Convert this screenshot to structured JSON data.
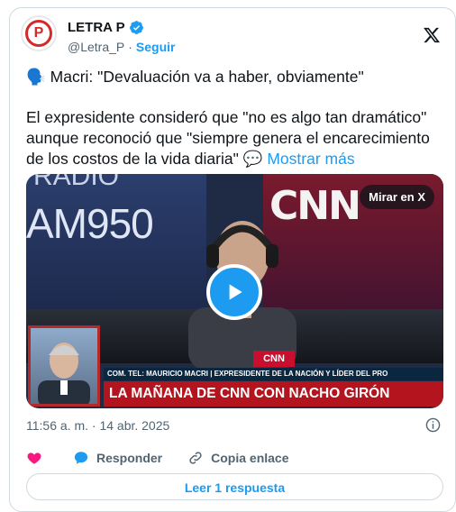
{
  "account": {
    "name": "LETRA P",
    "handle": "@Letra_P",
    "separator": "·",
    "follow_label": "Seguir",
    "avatar_letter": "P"
  },
  "tweet": {
    "line1": "🗣️ Macri: \"Devaluación va a haber, obviamente\"",
    "body": "El expresidente consideró que \"no es algo tan dramático\" aunque reconoció que \"siempre genera el encarecimiento de los costos de la vida diaria\"",
    "more_emoji": "💬",
    "more_label": "Mostrar más"
  },
  "media": {
    "watch_label": "Mirar en X",
    "radio_top": "RADIO",
    "radio_text": "AM950",
    "cnn_sign": "CNN",
    "cnn_mini": "CNN",
    "caption": "COM. TEL: MAURICIO MACRI | EXPRESIDENTE DE LA NACIÓN Y LÍDER DEL PRO",
    "headline": "LA MAÑANA DE CNN CON NACHO GIRÓN"
  },
  "timestamp": "11:56 a. m. · 14 abr. 2025",
  "actions": {
    "reply_label": "Responder",
    "copy_label": "Copia enlace"
  },
  "read_reply_label": "Leer 1 respuesta",
  "colors": {
    "accent": "#1d9bf0",
    "brand_red": "#d52a2a",
    "like": "#f91880",
    "headline_red": "#b4141e"
  }
}
